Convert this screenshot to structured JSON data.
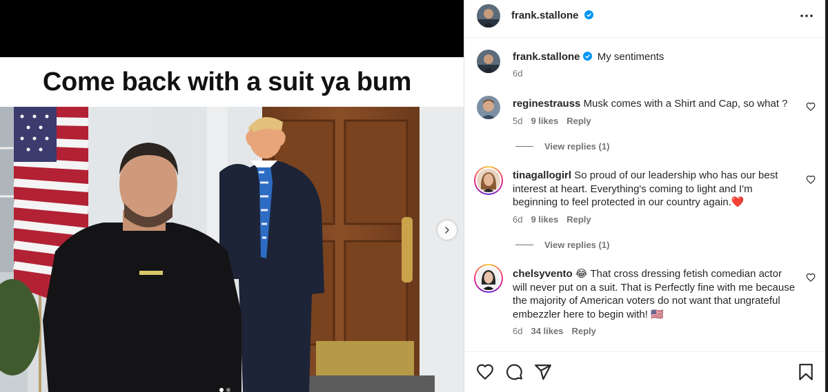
{
  "media": {
    "meme_caption": "Come back with a suit ya bum",
    "carousel": {
      "current_slide": 1,
      "total_slides": 2
    },
    "icons": {
      "next": "chevron-right-icon"
    }
  },
  "post": {
    "author": "frank.stallone",
    "author_verified": true,
    "caption_author": "frank.stallone",
    "caption": "My sentiments",
    "caption_time": "6d",
    "icons": {
      "more": "more-options-icon",
      "verified": "verified-badge-icon"
    }
  },
  "comments": [
    {
      "user": "reginestrauss",
      "text": "Musk comes with a Shirt and Cap, so what ?",
      "time": "5d",
      "likes": "9 likes",
      "reply_label": "Reply",
      "view_replies": "View replies (1)",
      "story_ring": false
    },
    {
      "user": "tinagallogirl",
      "text": "So proud of our leadership who has our best interest at heart. Everything's coming to light and I'm beginning to feel protected in our country again.❤️",
      "time": "6d",
      "likes": "9 likes",
      "reply_label": "Reply",
      "view_replies": "View replies (1)",
      "story_ring": true
    },
    {
      "user": "chelsyvento",
      "text": "😂 That cross dressing fetish comedian actor will never put on a suit. That is Perfectly fine with me because the majority of American voters do not want that ungrateful embezzler here to begin with! 🇺🇸",
      "time": "6d",
      "likes": "34 likes",
      "reply_label": "Reply",
      "story_ring": true
    }
  ],
  "actions": {
    "icons": [
      "heart-icon",
      "comment-icon",
      "share-icon",
      "bookmark-icon"
    ]
  },
  "colors": {
    "verified": "#0095f6",
    "secondary_text": "#737373",
    "primary_text": "#262626"
  }
}
